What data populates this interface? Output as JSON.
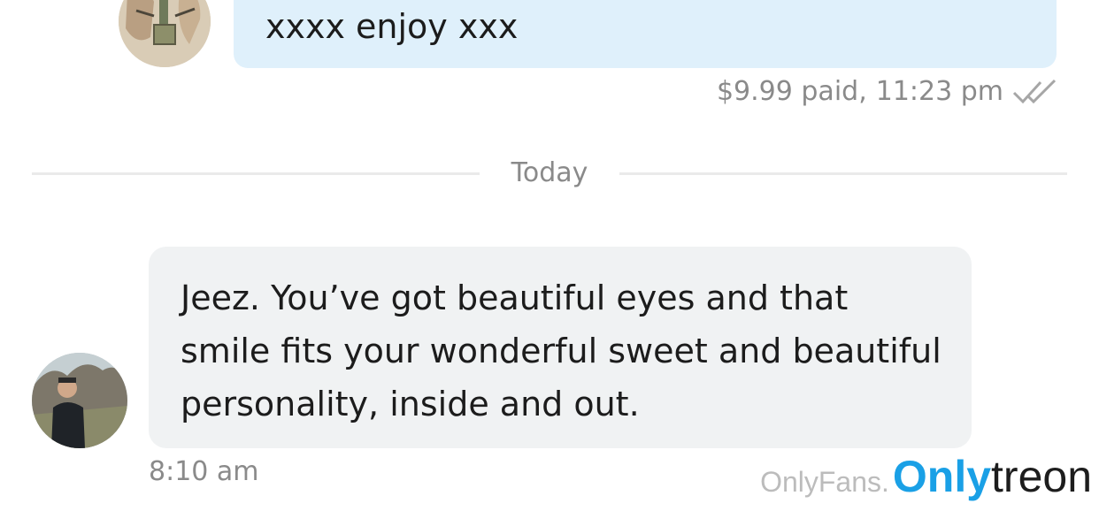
{
  "messages": [
    {
      "direction": "outgoing",
      "text": "xxxx enjoy xxx",
      "price_status": "$9.99 paid,",
      "time": "11:23 pm",
      "status_icon": "double-check-icon"
    },
    {
      "direction": "incoming",
      "text": "Jeez. You’ve got beautiful eyes and that smile fits your wonderful sweet and beautiful personality, inside and out.",
      "time": "8:10 am"
    }
  ],
  "divider": {
    "label": "Today"
  },
  "watermark": {
    "prefix": "OnlyFans.",
    "brand_a": "Only",
    "brand_b": "treon"
  },
  "colors": {
    "outgoing_bubble": "#dff0fb",
    "incoming_bubble": "#f0f2f3",
    "meta_text": "#8a8a8a",
    "brand_blue": "#1aa0e6"
  }
}
